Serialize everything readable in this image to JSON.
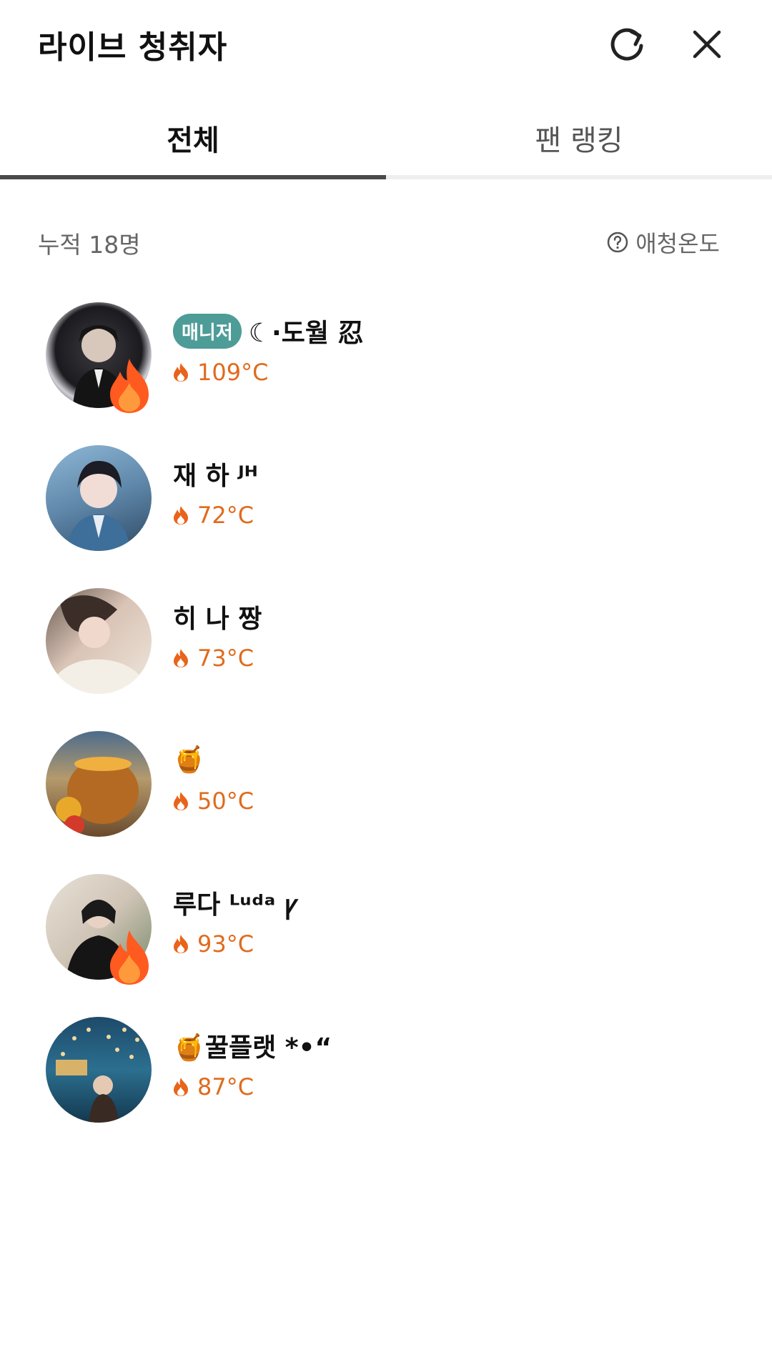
{
  "header": {
    "title": "라이브 청취자"
  },
  "tabs": [
    {
      "label": "전체",
      "active": true
    },
    {
      "label": "팬 랭킹",
      "active": false
    }
  ],
  "summary": {
    "count_text": "누적 18명",
    "temperature_label": "애청온도"
  },
  "listeners": [
    {
      "badge": "매니저",
      "name": "☾·도월 忍",
      "temperature": "109°C",
      "fire_badge": true
    },
    {
      "badge": "",
      "name": "재 하 ᴶᴴ",
      "temperature": "72°C",
      "fire_badge": false
    },
    {
      "badge": "",
      "name": "히 나 짱",
      "temperature": "73°C",
      "fire_badge": false
    },
    {
      "badge": "",
      "name": "🍯",
      "temperature": "50°C",
      "fire_badge": false
    },
    {
      "badge": "",
      "name": "루다 ᴸᵘᵈᵃ     ꝩ",
      "temperature": "93°C",
      "fire_badge": true
    },
    {
      "badge": "",
      "name": "🍯꿀플랫          *•“",
      "temperature": "87°C",
      "fire_badge": false
    }
  ],
  "icons": {
    "refresh": "refresh-icon",
    "close": "close-icon",
    "help": "question-circle-icon",
    "flame": "flame-icon"
  },
  "colors": {
    "accent_temperature": "#e06b1c",
    "manager_badge": "#4e9c98",
    "active_tab_indicator": "#4a4a4a"
  }
}
